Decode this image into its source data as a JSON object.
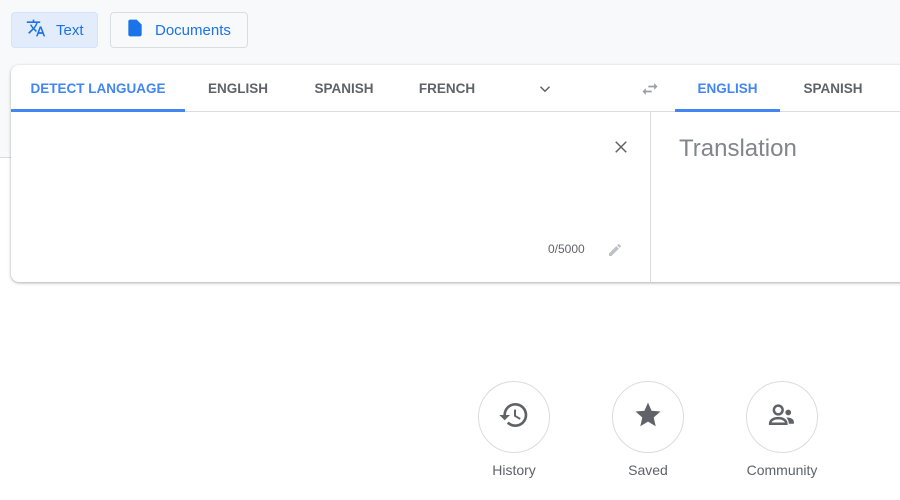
{
  "modes": [
    {
      "label": "Text",
      "icon": "translate-icon",
      "active": true
    },
    {
      "label": "Documents",
      "icon": "document-icon",
      "active": false
    }
  ],
  "source_tabs": [
    {
      "label": "DETECT LANGUAGE",
      "active": true
    },
    {
      "label": "ENGLISH"
    },
    {
      "label": "SPANISH"
    },
    {
      "label": "FRENCH"
    }
  ],
  "target_tabs": [
    {
      "label": "ENGLISH",
      "active": true
    },
    {
      "label": "SPANISH"
    }
  ],
  "source": {
    "value": "",
    "char_count": "0/5000"
  },
  "target": {
    "placeholder": "Translation"
  },
  "actions": [
    {
      "label": "History",
      "icon": "history-icon"
    },
    {
      "label": "Saved",
      "icon": "star-icon"
    },
    {
      "label": "Community",
      "icon": "community-icon"
    }
  ],
  "colors": {
    "accent": "#4285f4",
    "link": "#1a73e8",
    "text": "#5f6368"
  }
}
